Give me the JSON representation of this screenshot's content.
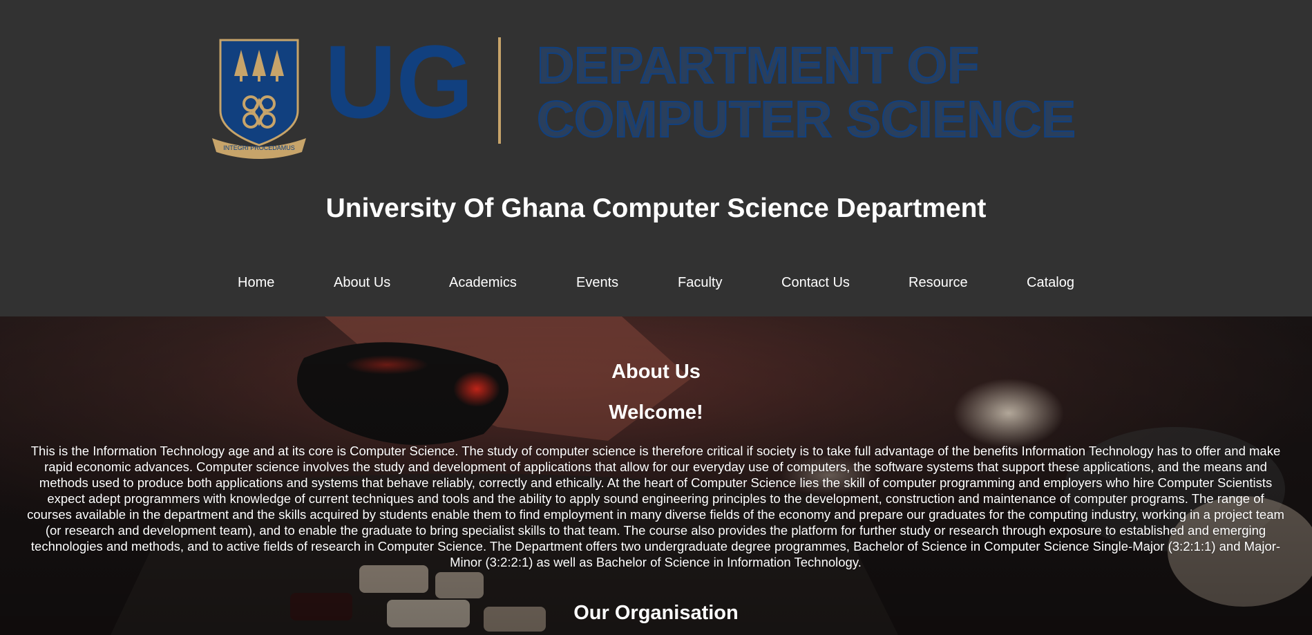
{
  "logo": {
    "ug": "UG",
    "dept_line1": "DEPARTMENT OF",
    "dept_line2": "COMPUTER SCIENCE",
    "motto": "INTEGRI PROCEDAMUS",
    "colors": {
      "blue": "#11407f",
      "gold": "#c7a46a"
    }
  },
  "header": {
    "title": "University Of Ghana Computer Science Department"
  },
  "nav": {
    "items": [
      {
        "label": "Home"
      },
      {
        "label": "About Us"
      },
      {
        "label": "Academics"
      },
      {
        "label": "Events"
      },
      {
        "label": "Faculty"
      },
      {
        "label": "Contact Us"
      },
      {
        "label": "Resource"
      },
      {
        "label": "Catalog"
      }
    ]
  },
  "about": {
    "heading": "About Us",
    "welcome": "Welcome!",
    "intro": "This is the Information Technology age and at its core is Computer Science. The study of computer science is therefore critical if society is to take full advantage of the benefits Information Technology has to offer and make rapid economic advances. Computer science involves the study and development of applications that allow for our everyday use of computers, the software systems that support these applications, and the means and methods used to produce both applications and systems that behave reliably, correctly and ethically. At the heart of Computer Science lies the skill of computer programming and employers who hire Computer Scientists expect adept programmers with knowledge of current techniques and tools and the ability to apply sound engineering principles to the development, construction and maintenance of computer programs. The range of courses available in the department and the skills acquired by students enable them to find employment in many diverse fields of the economy and prepare our graduates for the computing industry, working in a project team (or research and development team), and to enable the graduate to bring specialist skills to that team. The course also provides the platform for further study or research through exposure to established and emerging technologies and methods, and to active fields of research in Computer Science. The Department offers two undergraduate degree programmes, Bachelor of Science in Computer Science Single-Major (3:2:1:1) and Major-Minor (3:2:2:1) as well as Bachelor of Science in Information Technology.",
    "organisation_heading": "Our Organisation"
  }
}
